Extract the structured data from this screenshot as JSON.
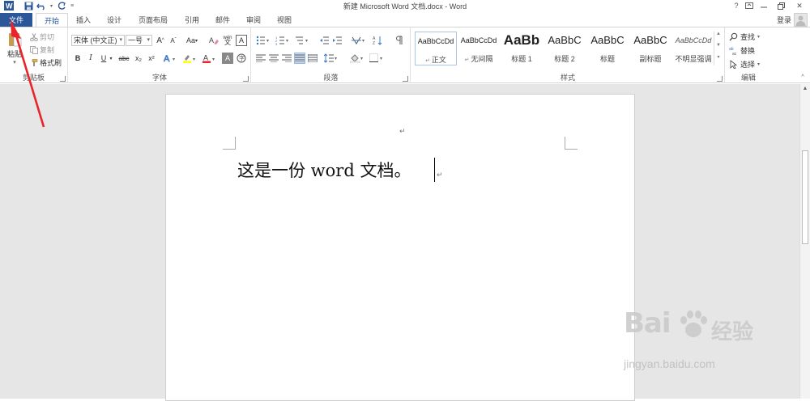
{
  "window": {
    "title": "新建 Microsoft Word 文档.docx - Word",
    "help": "?",
    "close": "✕"
  },
  "tabs": [
    "文件",
    "开始",
    "插入",
    "设计",
    "页面布局",
    "引用",
    "邮件",
    "审阅",
    "视图"
  ],
  "account": {
    "login": "登录"
  },
  "clipboard": {
    "paste": "粘贴",
    "cut": "剪切",
    "copy": "复制",
    "format_painter": "格式刷",
    "label": "剪贴板"
  },
  "font": {
    "name": "宋体 (中文正)",
    "size": "一号",
    "label": "字体",
    "bold": "B",
    "italic": "I",
    "underline": "U",
    "strike": "abc",
    "subscript": "x₂",
    "superscript": "x²",
    "change_case": "Aa",
    "grow": "A",
    "shrink": "A",
    "clear": "A",
    "phonetic": "wén",
    "border_char": "A",
    "shade_char": "A"
  },
  "paragraph": {
    "label": "段落"
  },
  "styles": {
    "label": "样式",
    "items": [
      {
        "preview": "AaBbCcDd",
        "name": "正文"
      },
      {
        "preview": "AaBbCcDd",
        "name": "无间隔"
      },
      {
        "preview": "AaBb",
        "name": "标题 1"
      },
      {
        "preview": "AaBbC",
        "name": "标题 2"
      },
      {
        "preview": "AaBbC",
        "name": "标题"
      },
      {
        "preview": "AaBbC",
        "name": "副标题"
      },
      {
        "preview": "AaBbCcDd",
        "name": "不明显强调"
      }
    ]
  },
  "editing": {
    "find": "查找",
    "replace": "替换",
    "select": "选择",
    "label": "编辑"
  },
  "document": {
    "text": "这是一份 word 文档。",
    "para_mark": "↵"
  },
  "watermark": {
    "logo": "Bai",
    "text": "经验",
    "url": "jingyan.baidu.com"
  },
  "colors": {
    "file_tab": "#2b579a",
    "accent": "#2b579a",
    "arrow": "#e8252a",
    "font_color": "#e8252a",
    "highlight": "#ffff00"
  }
}
